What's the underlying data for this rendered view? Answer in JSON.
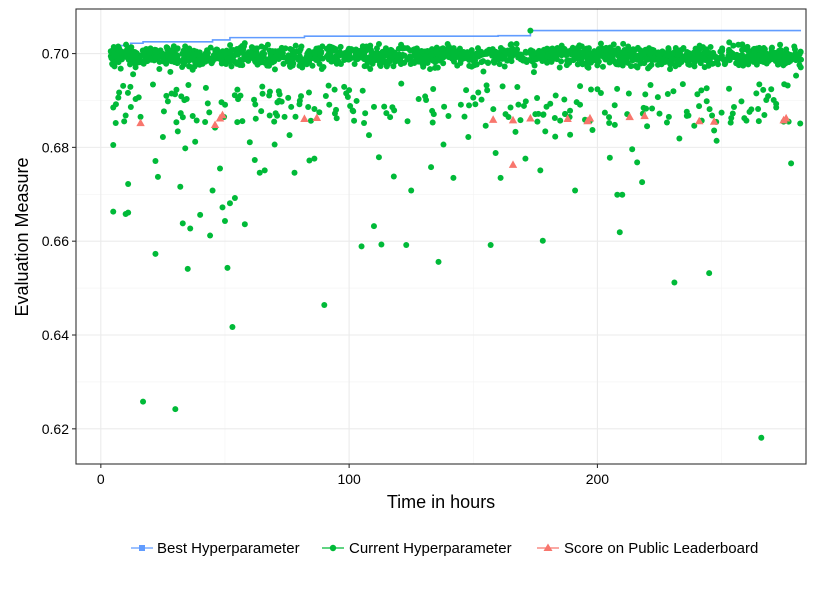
{
  "chart_data": {
    "type": "scatter",
    "xlabel": "Time in hours",
    "ylabel": "Evaluation Measure",
    "xlim": [
      -10,
      284
    ],
    "ylim": [
      0.6125,
      0.7095
    ],
    "x_ticks": [
      0,
      100,
      200
    ],
    "y_ticks": [
      0.62,
      0.64,
      0.66,
      0.68,
      0.7
    ],
    "x_tick_labels": [
      "0",
      "100",
      "200"
    ],
    "y_tick_labels": [
      "0.62",
      "0.64",
      "0.66",
      "0.68",
      "0.70"
    ],
    "grid": true,
    "legend_position": "bottom",
    "series": [
      {
        "name": "Best Hyperparameter",
        "kind": "step-line",
        "color": "#619CFF",
        "points": [
          [
            4,
            0.7005
          ],
          [
            7,
            0.7017
          ],
          [
            12,
            0.7022
          ],
          [
            17,
            0.7025
          ],
          [
            45,
            0.7029
          ],
          [
            52,
            0.7034
          ],
          [
            82,
            0.7037
          ],
          [
            160,
            0.7038
          ],
          [
            173,
            0.7049
          ],
          [
            282,
            0.7049
          ]
        ]
      },
      {
        "name": "Current Hyperparameter",
        "kind": "points",
        "color": "#00BA38",
        "points": [
          [
            4,
            0.7005
          ],
          [
            5,
            0.6885
          ],
          [
            5,
            0.6663
          ],
          [
            5,
            0.6805
          ],
          [
            6,
            0.6852
          ],
          [
            7,
            0.7015
          ],
          [
            8,
            0.6968
          ],
          [
            9,
            0.6931
          ],
          [
            10,
            0.6868
          ],
          [
            10,
            0.6658
          ],
          [
            11,
            0.6722
          ],
          [
            11,
            0.6661
          ],
          [
            12,
            0.7002
          ],
          [
            13,
            0.6956
          ],
          [
            14,
            0.6903
          ],
          [
            15,
            0.6981
          ],
          [
            16,
            0.6865
          ],
          [
            17,
            0.6258
          ],
          [
            18,
            0.6993
          ],
          [
            20,
            0.7011
          ],
          [
            21,
            0.6934
          ],
          [
            22,
            0.6771
          ],
          [
            22,
            0.6573
          ],
          [
            23,
            0.6737
          ],
          [
            25,
            0.6822
          ],
          [
            27,
            0.6898
          ],
          [
            28,
            0.6961
          ],
          [
            30,
            0.6242
          ],
          [
            31,
            0.6834
          ],
          [
            32,
            0.6716
          ],
          [
            33,
            0.6638
          ],
          [
            34,
            0.6798
          ],
          [
            35,
            0.6541
          ],
          [
            36,
            0.6627
          ],
          [
            37,
            0.6867
          ],
          [
            38,
            0.6812
          ],
          [
            40,
            0.6656
          ],
          [
            42,
            0.6854
          ],
          [
            44,
            0.6612
          ],
          [
            45,
            0.6708
          ],
          [
            46,
            0.6842
          ],
          [
            48,
            0.6755
          ],
          [
            49,
            0.6672
          ],
          [
            50,
            0.6643
          ],
          [
            51,
            0.6543
          ],
          [
            52,
            0.6681
          ],
          [
            53,
            0.6417
          ],
          [
            54,
            0.6692
          ],
          [
            55,
            0.6923
          ],
          [
            57,
            0.6856
          ],
          [
            58,
            0.6636
          ],
          [
            60,
            0.6811
          ],
          [
            62,
            0.6773
          ],
          [
            64,
            0.6746
          ],
          [
            66,
            0.6751
          ],
          [
            68,
            0.6868
          ],
          [
            70,
            0.6806
          ],
          [
            72,
            0.6913
          ],
          [
            74,
            0.6865
          ],
          [
            76,
            0.6826
          ],
          [
            78,
            0.6746
          ],
          [
            80,
            0.6892
          ],
          [
            82,
            0.6984
          ],
          [
            84,
            0.6772
          ],
          [
            86,
            0.6776
          ],
          [
            88,
            0.6875
          ],
          [
            90,
            0.6464
          ],
          [
            92,
            0.6891
          ],
          [
            95,
            0.6862
          ],
          [
            98,
            0.6929
          ],
          [
            100,
            0.6922
          ],
          [
            103,
            0.6899
          ],
          [
            105,
            0.6589
          ],
          [
            106,
            0.6852
          ],
          [
            108,
            0.6826
          ],
          [
            110,
            0.6632
          ],
          [
            112,
            0.6779
          ],
          [
            113,
            0.6593
          ],
          [
            115,
            0.6873
          ],
          [
            118,
            0.6738
          ],
          [
            121,
            0.6936
          ],
          [
            123,
            0.6592
          ],
          [
            125,
            0.6708
          ],
          [
            128,
            0.6903
          ],
          [
            131,
            0.6901
          ],
          [
            133,
            0.6758
          ],
          [
            136,
            0.6556
          ],
          [
            138,
            0.6806
          ],
          [
            140,
            0.6867
          ],
          [
            142,
            0.6735
          ],
          [
            145,
            0.6891
          ],
          [
            148,
            0.6822
          ],
          [
            150,
            0.6906
          ],
          [
            152,
            0.6917
          ],
          [
            155,
            0.6846
          ],
          [
            157,
            0.6592
          ],
          [
            159,
            0.6788
          ],
          [
            161,
            0.6735
          ],
          [
            163,
            0.6871
          ],
          [
            165,
            0.6885
          ],
          [
            167,
            0.6833
          ],
          [
            169,
            0.6858
          ],
          [
            171,
            0.6776
          ],
          [
            173,
            0.7049
          ],
          [
            175,
            0.6871
          ],
          [
            177,
            0.6751
          ],
          [
            178,
            0.6601
          ],
          [
            179,
            0.6834
          ],
          [
            181,
            0.6893
          ],
          [
            183,
            0.6823
          ],
          [
            185,
            0.6857
          ],
          [
            187,
            0.6871
          ],
          [
            189,
            0.6827
          ],
          [
            191,
            0.6708
          ],
          [
            193,
            0.6891
          ],
          [
            195,
            0.6859
          ],
          [
            198,
            0.6837
          ],
          [
            200,
            0.6924
          ],
          [
            203,
            0.6874
          ],
          [
            205,
            0.6778
          ],
          [
            207,
            0.6848
          ],
          [
            208,
            0.6699
          ],
          [
            209,
            0.6619
          ],
          [
            210,
            0.6699
          ],
          [
            212,
            0.6871
          ],
          [
            214,
            0.6796
          ],
          [
            216,
            0.6768
          ],
          [
            218,
            0.6726
          ],
          [
            220,
            0.6845
          ],
          [
            222,
            0.6883
          ],
          [
            225,
            0.6872
          ],
          [
            228,
            0.6853
          ],
          [
            231,
            0.6512
          ],
          [
            233,
            0.6819
          ],
          [
            236,
            0.6876
          ],
          [
            239,
            0.6846
          ],
          [
            242,
            0.6857
          ],
          [
            244,
            0.6926
          ],
          [
            245,
            0.6532
          ],
          [
            247,
            0.6836
          ],
          [
            248,
            0.6814
          ],
          [
            250,
            0.6874
          ],
          [
            253,
            0.6925
          ],
          [
            255,
            0.6886
          ],
          [
            258,
            0.6898
          ],
          [
            260,
            0.6857
          ],
          [
            262,
            0.6881
          ],
          [
            264,
            0.6915
          ],
          [
            265,
            0.6856
          ],
          [
            266,
            0.6181
          ],
          [
            268,
            0.6901
          ],
          [
            270,
            0.6924
          ],
          [
            272,
            0.6885
          ],
          [
            275,
            0.6855
          ],
          [
            277,
            0.6855
          ],
          [
            278,
            0.6766
          ],
          [
            280,
            0.6953
          ],
          [
            282,
            0.6987
          ]
        ]
      },
      {
        "name": "Score on Public Leaderboard",
        "kind": "triangles",
        "color": "#F8766D",
        "points": [
          [
            16,
            0.6852
          ],
          [
            46,
            0.6848
          ],
          [
            48,
            0.6862
          ],
          [
            49,
            0.6869
          ],
          [
            82,
            0.6861
          ],
          [
            87,
            0.6863
          ],
          [
            158,
            0.6859
          ],
          [
            166,
            0.6763
          ],
          [
            166,
            0.6858
          ],
          [
            173,
            0.6862
          ],
          [
            188,
            0.6861
          ],
          [
            196,
            0.6856
          ],
          [
            197,
            0.6862
          ],
          [
            213,
            0.6865
          ],
          [
            219,
            0.6867
          ],
          [
            241,
            0.6856
          ],
          [
            247,
            0.6855
          ],
          [
            275,
            0.6858
          ],
          [
            276,
            0.6862
          ]
        ]
      }
    ]
  }
}
